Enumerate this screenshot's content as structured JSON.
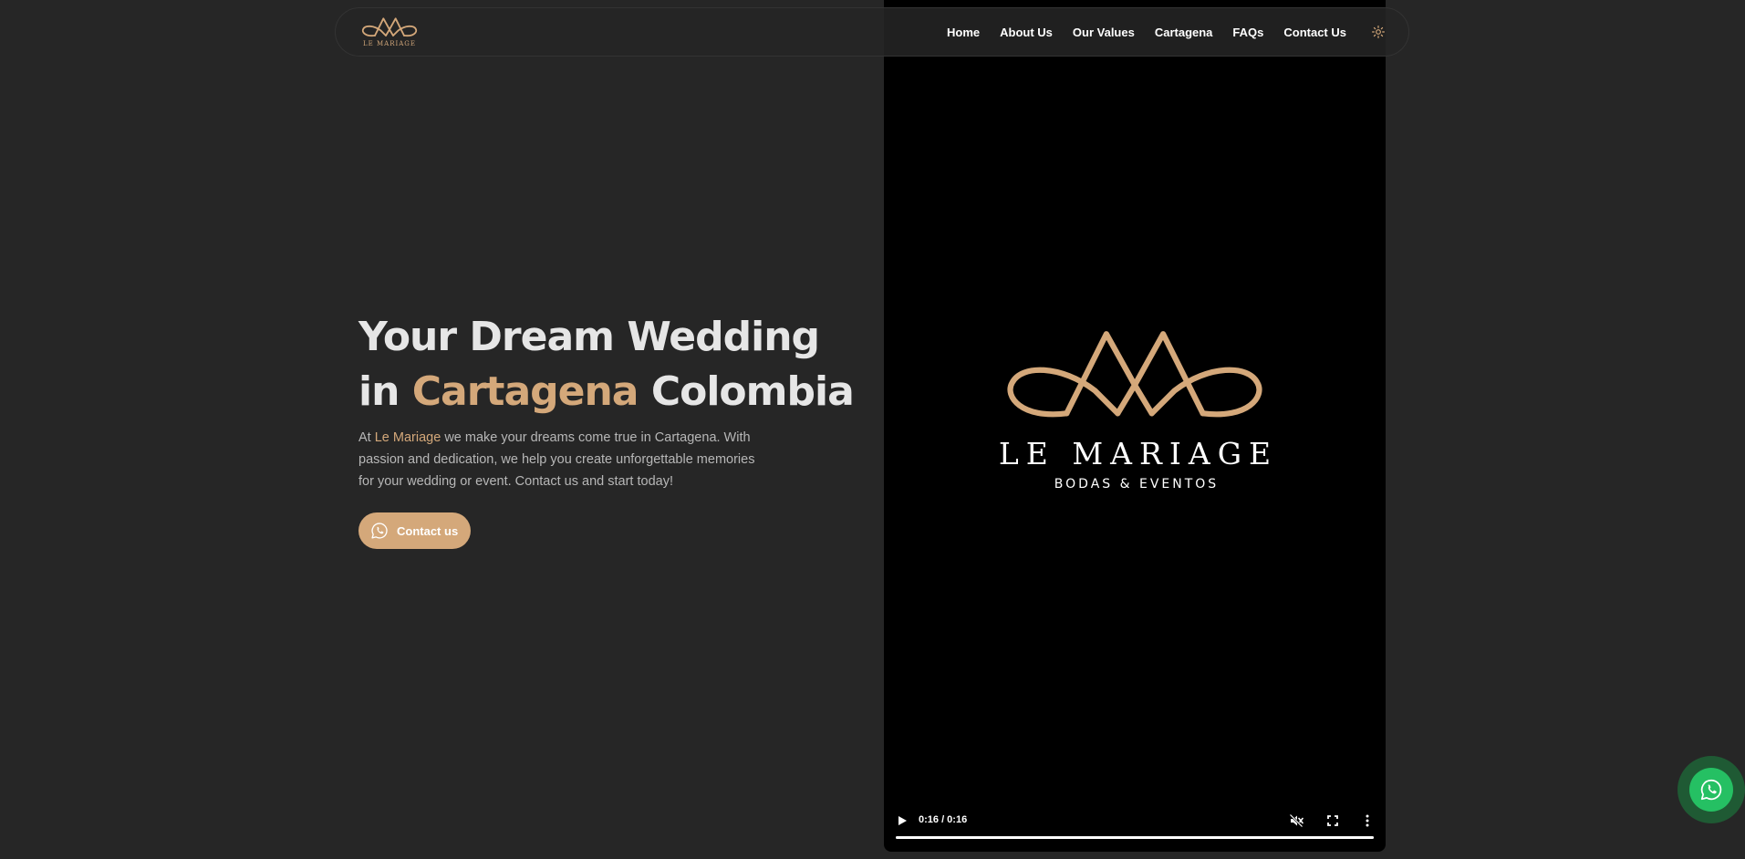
{
  "nav": {
    "logo_text": "LE MARIAGE",
    "links": [
      {
        "label": "Home"
      },
      {
        "label": "About Us"
      },
      {
        "label": "Our Values"
      },
      {
        "label": "Cartagena"
      },
      {
        "label": "FAQs"
      },
      {
        "label": "Contact Us"
      }
    ],
    "theme_icon": "sun-icon"
  },
  "hero": {
    "title_line1": "Your Dream Wedding",
    "title_in": "in",
    "title_accent": "Cartagena",
    "title_end": "Colombia",
    "desc_prefix": "At",
    "desc_brand": "Le Mariage",
    "desc_rest": "we make your dreams come true in Cartagena. With passion and dedication, we help you create unforgettable memories for your wedding or event. Contact us and start today!",
    "cta_label": "Contact us",
    "cta_icon": "whatsapp-icon"
  },
  "video": {
    "brand": "LE MARIAGE",
    "subtitle": "BODAS & EVENTOS",
    "time": "0:16 / 0:16",
    "progress": 1.0,
    "icons": [
      "play-icon",
      "muted-icon",
      "fullscreen-icon",
      "more-vert-icon"
    ]
  },
  "whatsapp_float": {
    "icon": "whatsapp-icon"
  },
  "colors": {
    "background": "#262626",
    "accent": "#d4a87a",
    "video_bg": "#000000",
    "whatsapp_green": "#25c063"
  }
}
